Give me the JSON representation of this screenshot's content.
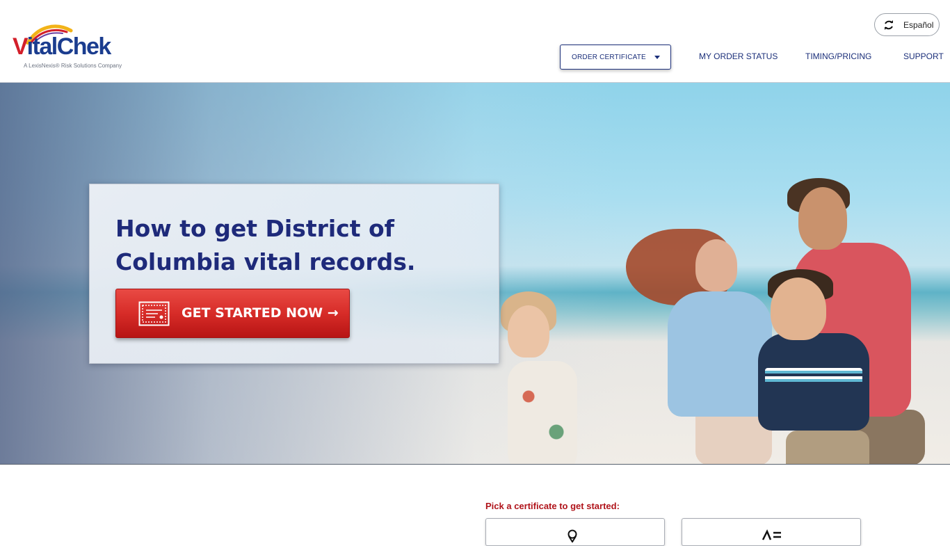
{
  "header": {
    "logo": {
      "brand": "VitalChek",
      "tagline": "A LexisNexis® Risk Solutions Company"
    },
    "language_button": {
      "label": "Español",
      "icon": "refresh-icon"
    },
    "nav": {
      "order_certificate": "ORDER CERTIFICATE",
      "my_order_status": "MY ORDER STATUS",
      "timing_pricing": "TIMING/PRICING",
      "support": "SUPPORT"
    }
  },
  "hero": {
    "title": "How to get District of Columbia vital records.",
    "cta_label": "GET STARTED NOW →",
    "cta_icon": "certificate-icon"
  },
  "certificates": {
    "prompt": "Pick a certificate to get started:",
    "cards": [
      {
        "icon": "location-pin-icon"
      },
      {
        "icon": "certificate-type-icon"
      }
    ]
  },
  "colors": {
    "brand_blue": "#1e2a7a",
    "cta_red": "#d72c28",
    "prompt_red": "#b0141b"
  }
}
